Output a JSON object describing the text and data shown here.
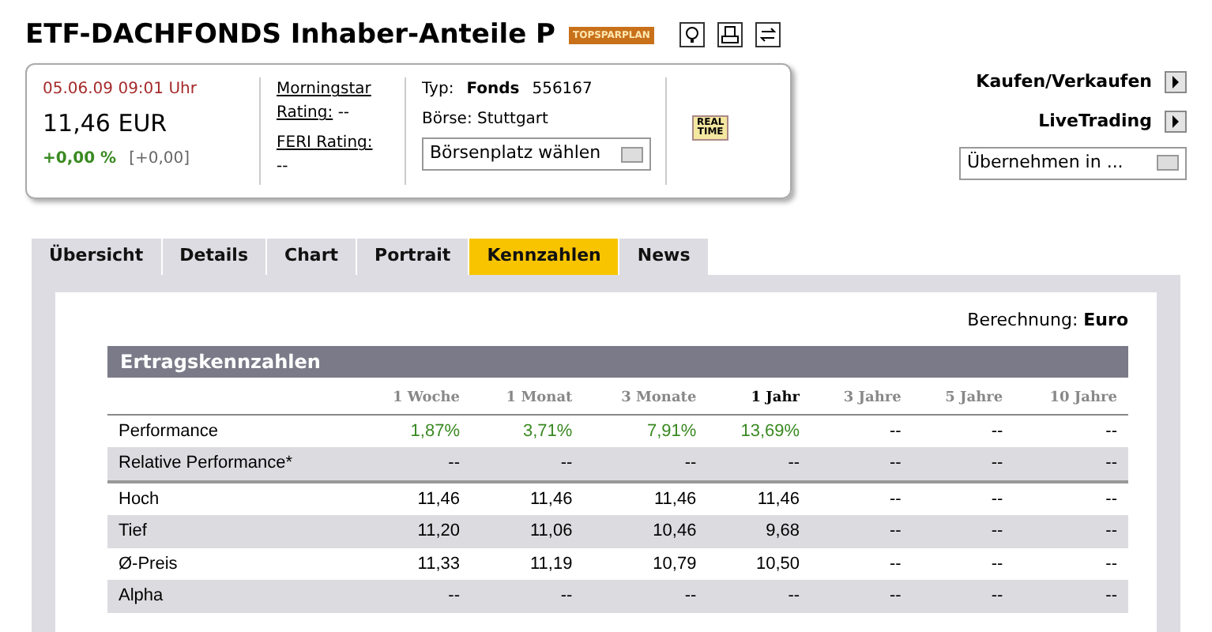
{
  "header": {
    "title": "ETF-DACHFONDS Inhaber-Anteile P",
    "badge": "TOPSPARPLAN"
  },
  "quote": {
    "timestamp": "05.06.09 09:01 Uhr",
    "price": "11,46 EUR",
    "change_pct": "+0,00 %",
    "change_abs": "[+0,00]",
    "morningstar_label": [
      "Morningstar",
      "Rating:"
    ],
    "morningstar_value": "--",
    "feri_label": "FERI Rating:",
    "feri_value": "--",
    "type_label": "Typ:",
    "type_value": "Fonds",
    "wkn": "556167",
    "exchange": "Börse: Stuttgart",
    "exchange_select": "Börsenplatz wählen",
    "realtime_badge": [
      "REAL",
      "TIME"
    ]
  },
  "actions": [
    {
      "label": "Kaufen/Verkaufen"
    },
    {
      "label": "LiveTrading"
    }
  ],
  "transfer_select": "Übernehmen in ...",
  "tabs": [
    {
      "label": "Übersicht",
      "selected": false
    },
    {
      "label": "Details",
      "selected": false
    },
    {
      "label": "Chart",
      "selected": false
    },
    {
      "label": "Portrait",
      "selected": false
    },
    {
      "label": "Kennzahlen",
      "selected": true
    },
    {
      "label": "News",
      "selected": false
    }
  ],
  "calculation": {
    "label": "Berechnung:",
    "value": "Euro"
  },
  "table": {
    "title": "Ertragskennzahlen",
    "columns": [
      {
        "label": "1 Woche",
        "selected": false
      },
      {
        "label": "1 Monat",
        "selected": false
      },
      {
        "label": "3 Monate",
        "selected": false
      },
      {
        "label": "1 Jahr",
        "selected": true
      },
      {
        "label": "3 Jahre",
        "selected": false
      },
      {
        "label": "5 Jahre",
        "selected": false
      },
      {
        "label": "10 Jahre",
        "selected": false
      }
    ],
    "rows": [
      {
        "kind": "performance",
        "label": "Performance",
        "cells": [
          "1,87%",
          "3,71%",
          "7,91%",
          "13,69%",
          "--",
          "--",
          "--"
        ]
      },
      {
        "kind": "relative",
        "label": "Relative Performance*",
        "cells": [
          "--",
          "--",
          "--",
          "--",
          "--",
          "--",
          "--"
        ]
      },
      {
        "kind": "price",
        "label": "Hoch",
        "cells": [
          "11,46",
          "11,46",
          "11,46",
          "11,46",
          "--",
          "--",
          "--"
        ]
      },
      {
        "kind": "price",
        "label": "Tief",
        "cells": [
          "11,20",
          "11,06",
          "10,46",
          "9,68",
          "--",
          "--",
          "--"
        ]
      },
      {
        "kind": "price",
        "label": "Ø-Preis",
        "cells": [
          "11,33",
          "11,19",
          "10,79",
          "10,50",
          "--",
          "--",
          "--"
        ]
      },
      {
        "kind": "price",
        "label": "Alpha",
        "cells": [
          "--",
          "--",
          "--",
          "--",
          "--",
          "--",
          "--"
        ]
      }
    ]
  }
}
